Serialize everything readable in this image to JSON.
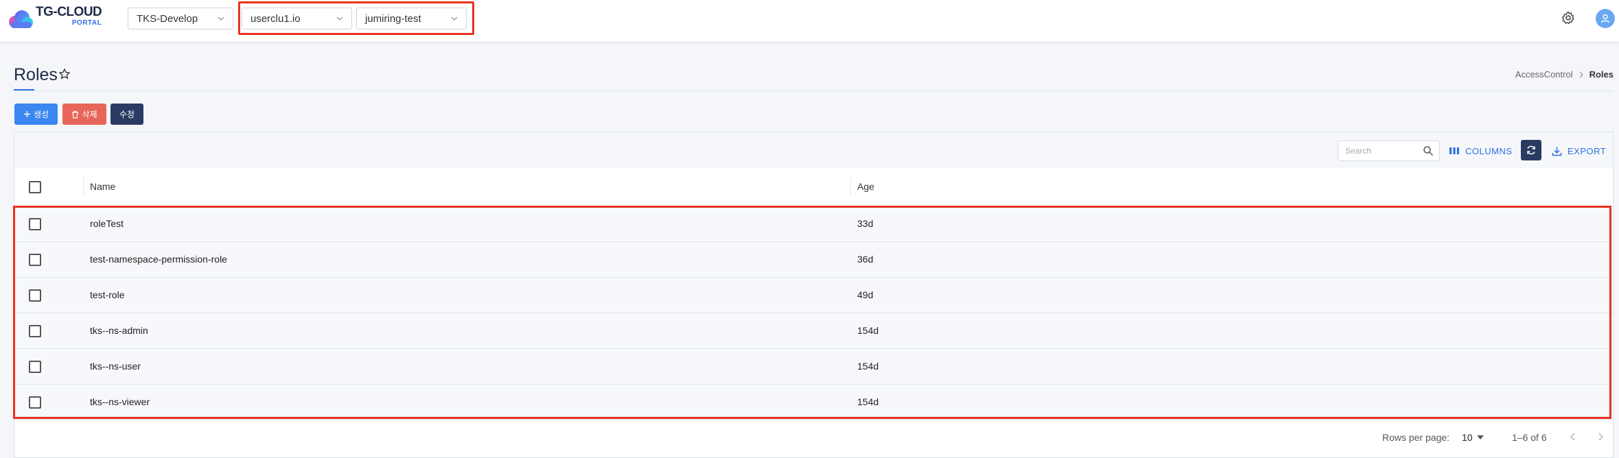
{
  "brand": {
    "name": "TG-CLOUD",
    "sub": "PORTAL"
  },
  "selectors": {
    "project": "TKS-Develop",
    "cluster": "userclu1.io",
    "namespace": "jumiring-test"
  },
  "page": {
    "title": "Roles"
  },
  "breadcrumb": {
    "parent": "AccessControl",
    "current": "Roles"
  },
  "actions": {
    "create": "생성",
    "delete": "삭제",
    "edit": "수정"
  },
  "toolbar": {
    "search_placeholder": "Search",
    "columns": "COLUMNS",
    "export": "EXPORT"
  },
  "table": {
    "headers": {
      "name": "Name",
      "age": "Age"
    },
    "rows": [
      {
        "name": "roleTest",
        "age": "33d"
      },
      {
        "name": "test-namespace-permission-role",
        "age": "36d"
      },
      {
        "name": "test-role",
        "age": "49d"
      },
      {
        "name": "tks--ns-admin",
        "age": "154d"
      },
      {
        "name": "tks--ns-user",
        "age": "154d"
      },
      {
        "name": "tks--ns-viewer",
        "age": "154d"
      }
    ]
  },
  "pagination": {
    "rows_per_page_label": "Rows per page:",
    "rows_per_page": "10",
    "range": "1–6 of 6"
  },
  "colors": {
    "accent": "#2f6fe0",
    "create": "#3b86f0",
    "delete": "#e8655a",
    "edit": "#2a3b63",
    "highlight": "#e8321f"
  }
}
